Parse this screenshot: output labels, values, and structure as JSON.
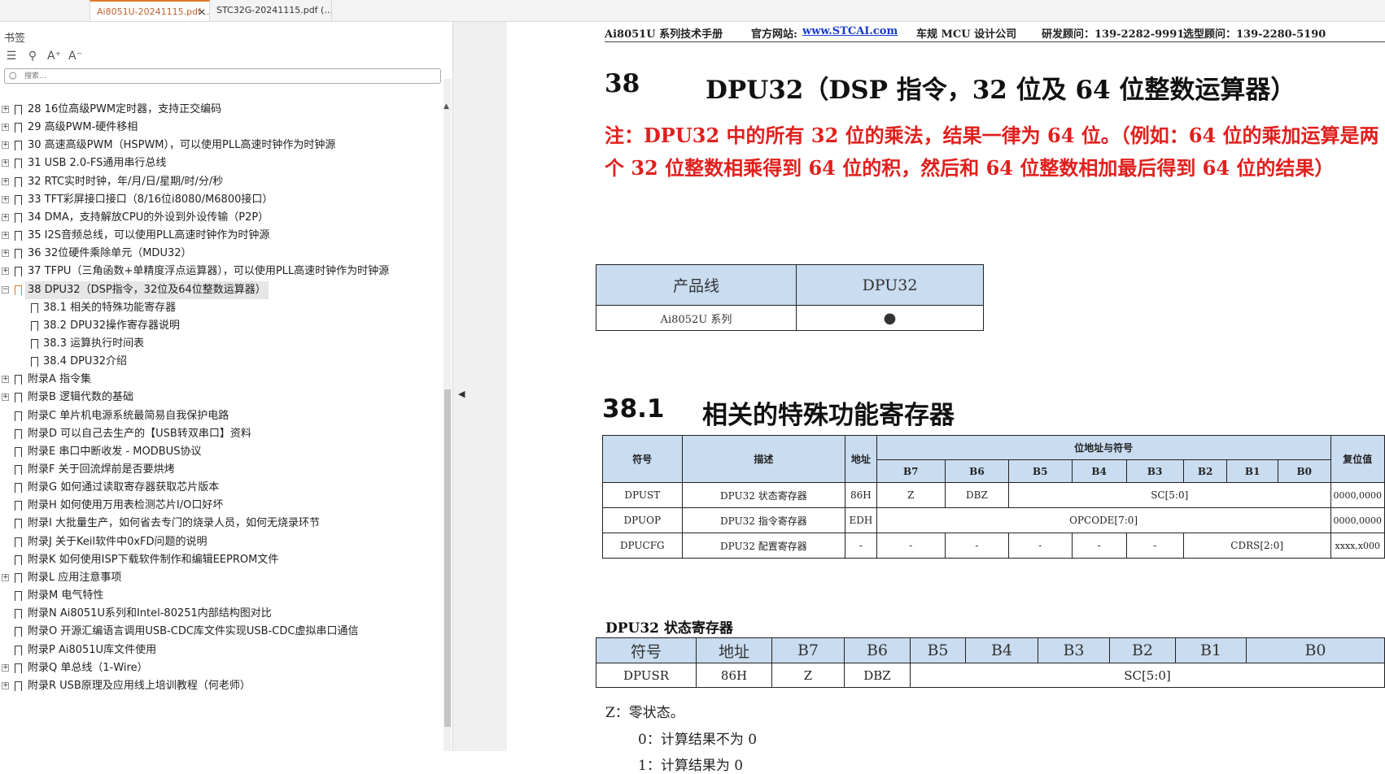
{
  "tabs": [
    {
      "label": "Ai8051U-20241115.pdf ...",
      "close": "✕"
    },
    {
      "label": "STC32G-20241115.pdf (..."
    }
  ],
  "sidebar": {
    "title": "书签",
    "search_placeholder": "搜索...",
    "icons": [
      "list-icon",
      "bookmark-search-icon",
      "font-increase-icon",
      "font-decrease-icon"
    ],
    "items": [
      {
        "label": "28  16位高级PWM定时器，支持正交编码",
        "level": 0,
        "expandable": true
      },
      {
        "label": "29  高级PWM-硬件移相",
        "level": 0,
        "expandable": true
      },
      {
        "label": "30  高速高级PWM（HSPWM），可以使用PLL高速时钟作为时钟源",
        "level": 0,
        "expandable": true
      },
      {
        "label": "31  USB 2.0-FS通用串行总线",
        "level": 0,
        "expandable": true
      },
      {
        "label": "32  RTC实时时钟，年/月/日/星期/时/分/秒",
        "level": 0,
        "expandable": true
      },
      {
        "label": "33  TFT彩屏接口接口（8/16位i8080/M6800接口）",
        "level": 0,
        "expandable": true
      },
      {
        "label": "34  DMA，支持解放CPU的外设到外设传输（P2P）",
        "level": 0,
        "expandable": true
      },
      {
        "label": "35  I2S音频总线，可以使用PLL高速时钟作为时钟源",
        "level": 0,
        "expandable": true
      },
      {
        "label": "36  32位硬件乘除单元（MDU32）",
        "level": 0,
        "expandable": true
      },
      {
        "label": "37  TFPU（三角函数+单精度浮点运算器），可以使用PLL高速时钟作为时钟源",
        "level": 0,
        "expandable": true
      },
      {
        "label": "38  DPU32（DSP指令，32位及64位整数运算器）",
        "level": 0,
        "expandable": true,
        "expanded": true,
        "selected": true
      },
      {
        "label": "38.1 相关的特殊功能寄存器",
        "level": 1
      },
      {
        "label": "38.2  DPU32操作寄存器说明",
        "level": 1
      },
      {
        "label": "38.3 运算执行时间表",
        "level": 1
      },
      {
        "label": "38.4  DPU32介绍",
        "level": 1
      },
      {
        "label": "附录A  指令集",
        "level": 0,
        "expandable": true
      },
      {
        "label": "附录B  逻辑代数的基础",
        "level": 0,
        "expandable": true
      },
      {
        "label": "附录C  单片机电源系统最简易自我保护电路",
        "level": 0
      },
      {
        "label": "附录D  可以自己去生产的【USB转双串口】资料",
        "level": 0
      },
      {
        "label": "附录E  串口中断收发 - MODBUS协议",
        "level": 0
      },
      {
        "label": "附录F  关于回流焊前是否要烘烤",
        "level": 0
      },
      {
        "label": "附录G  如何通过读取寄存器获取芯片版本",
        "level": 0
      },
      {
        "label": "附录H  如何使用万用表检测芯片I/O口好坏",
        "level": 0
      },
      {
        "label": "附录I  大批量生产，如何省去专门的烧录人员，如何无烧录环节",
        "level": 0
      },
      {
        "label": "附录J  关于Keil软件中0xFD问题的说明",
        "level": 0
      },
      {
        "label": "附录K  如何使用ISP下载软件制作和编辑EEPROM文件",
        "level": 0
      },
      {
        "label": "附录L  应用注意事项",
        "level": 0,
        "expandable": true
      },
      {
        "label": "附录M  电气特性",
        "level": 0
      },
      {
        "label": "附录N  Ai8051U系列和Intel-80251内部结构图对比",
        "level": 0
      },
      {
        "label": "附录O  开源汇编语言调用USB-CDC库文件实现USB-CDC虚拟串口通信",
        "level": 0
      },
      {
        "label": "附录P  Ai8051U库文件使用",
        "level": 0
      },
      {
        "label": "附录Q  单总线（1-Wire）",
        "level": 0,
        "expandable": true
      },
      {
        "label": "附录R USB原理及应用线上培训教程（何老师）",
        "level": 0,
        "expandable": true
      }
    ]
  },
  "page": {
    "header": {
      "manual": "Ai8051U 系列技术手册",
      "site_label": "官方网站:",
      "site_link": "www.STCAI.com",
      "company": "车规 MCU 设计公司",
      "rd_contact": "研发顾问：139-2282-9991",
      "sel_contact": "选型顾问：139-2280-5190"
    },
    "chapter_num": "38",
    "chapter_title": "DPU32（DSP 指令，32 位及 64 位整数运算器）",
    "note": "注：DPU32 中的所有 32 位的乘法，结果一律为 64 位。（例如：64 位的乘加运算是两个 32 位整数相乘得到 64 位的积，然后和 64 位整数相加最后得到 64 位的结果）",
    "product_table": {
      "headers": [
        "产品线",
        "DPU32"
      ],
      "row": [
        "Ai8052U 系列",
        "●"
      ]
    },
    "section_num": "38.1",
    "section_title": "相关的特殊功能寄存器",
    "sfr_table": {
      "h_symbol": "符号",
      "h_desc": "描述",
      "h_addr": "地址",
      "h_bits": "位地址与符号",
      "h_reset": "复位值",
      "bits": [
        "B7",
        "B6",
        "B5",
        "B4",
        "B3",
        "B2",
        "B1",
        "B0"
      ],
      "rows": [
        {
          "symbol": "DPUST",
          "desc": "DPU32 状态寄存器",
          "addr": "86H",
          "b7": "Z",
          "b6": "DBZ",
          "rest": "SC[5:0]",
          "reset": "0000,0000"
        },
        {
          "symbol": "DPUOP",
          "desc": "DPU32 指令寄存器",
          "addr": "EDH",
          "all": "OPCODE[7:0]",
          "reset": "0000,0000"
        },
        {
          "symbol": "DPUCFG",
          "desc": "DPU32 配置寄存器",
          "addr": "-",
          "b7": "-",
          "b6": "-",
          "b5": "-",
          "b4": "-",
          "b3": "-",
          "cdrs": "CDRS[2:0]",
          "reset": "xxxx,x000"
        }
      ]
    },
    "status_title": "DPU32 状态寄存器",
    "status_table": {
      "headers": [
        "符号",
        "地址",
        "B7",
        "B6",
        "B5",
        "B4",
        "B3",
        "B2",
        "B1",
        "B0"
      ],
      "row": {
        "symbol": "DPUSR",
        "addr": "86H",
        "b7": "Z",
        "b6": "DBZ",
        "rest": "SC[5:0]"
      }
    },
    "z_desc": "Z：零状态。",
    "z0": "0：计算结果不为 0",
    "z1": "1：计算结果为 0"
  }
}
